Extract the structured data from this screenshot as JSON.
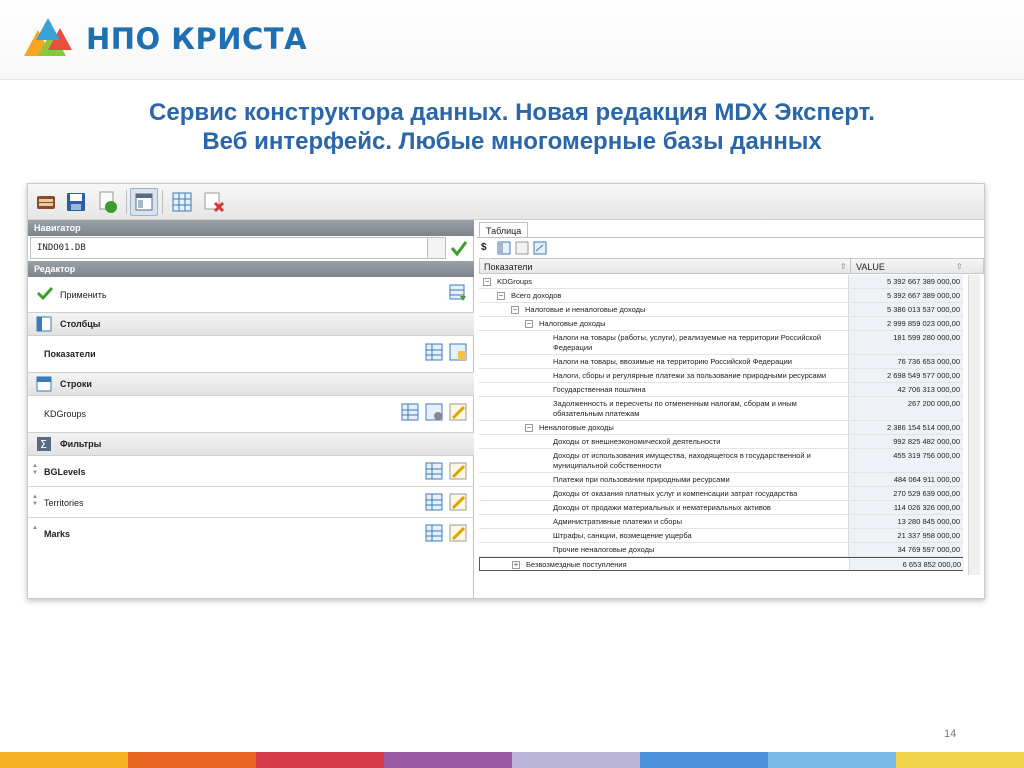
{
  "brand": {
    "name": "НПО КРИСТА"
  },
  "slide": {
    "title_line1": "Сервис конструктора данных. Новая редакция MDX Эксперт.",
    "title_line2": "Веб интерфейс. Любые многомерные базы данных",
    "page_number": "14"
  },
  "toolbar": {
    "buttons": [
      "open-icon",
      "save-icon",
      "run-icon",
      "layout-icon",
      "table-icon",
      "delete-table-icon"
    ]
  },
  "left": {
    "navigator_label": "Навигатор",
    "navigator_value": "INDO01.DB",
    "editor_label": "Редактор",
    "apply_label": "Применить",
    "columns_label": "Столбцы",
    "columns_item": "Показатели",
    "rows_label": "Строки",
    "rows_item": "KDGroups",
    "filters_label": "Фильтры",
    "filters": [
      "BGLevels",
      "Territories",
      "Marks"
    ]
  },
  "right": {
    "tab_label": "Таблица",
    "col_indicators": "Показатели",
    "col_value": "VALUE",
    "rows": [
      {
        "level": 0,
        "toggle": "minus",
        "name": "KDGroups",
        "value": "5 392 667 389 000,00"
      },
      {
        "level": 1,
        "toggle": "minus",
        "name": "Всего доходов",
        "value": "5 392 667 389 000,00"
      },
      {
        "level": 2,
        "toggle": "minus",
        "name": "Налоговые и неналоговые доходы",
        "value": "5 386 013 537 000,00"
      },
      {
        "level": 3,
        "toggle": "minus",
        "name": "Налоговые доходы",
        "value": "2 999 859 023 000,00"
      },
      {
        "level": 4,
        "toggle": "",
        "name": "Налоги на товары (работы, услуги), реализуемые на территории Российской Федерации",
        "value": "181 599 280 000,00",
        "tall": true
      },
      {
        "level": 4,
        "toggle": "",
        "name": "Налоги на товары, ввозимые на территорию Российской Федерации",
        "value": "76 736 653 000,00"
      },
      {
        "level": 4,
        "toggle": "",
        "name": "Налоги, сборы и регулярные платежи за пользование природными ресурсами",
        "value": "2 698 549 577 000,00"
      },
      {
        "level": 4,
        "toggle": "",
        "name": "Государственная пошлина",
        "value": "42 706 313 000,00"
      },
      {
        "level": 4,
        "toggle": "",
        "name": "Задолженность и пересчеты по отмененным налогам, сборам и иным обязательным платежам",
        "value": "267 200 000,00",
        "tall": true
      },
      {
        "level": 3,
        "toggle": "minus",
        "name": "Неналоговые доходы",
        "value": "2 386 154 514 000,00"
      },
      {
        "level": 4,
        "toggle": "",
        "name": "Доходы от внешнеэкономической деятельности",
        "value": "992 825 482 000,00"
      },
      {
        "level": 4,
        "toggle": "",
        "name": "Доходы от использования имущества, находящегося в государственной и муниципальной собственности",
        "value": "455 319 756 000,00",
        "tall": true
      },
      {
        "level": 4,
        "toggle": "",
        "name": "Платежи при пользовании природными ресурсами",
        "value": "484 064 911 000,00"
      },
      {
        "level": 4,
        "toggle": "",
        "name": "Доходы от оказания платных услуг и компенсации затрат государства",
        "value": "270 529 639 000,00"
      },
      {
        "level": 4,
        "toggle": "",
        "name": "Доходы от продажи материальных и нематериальных активов",
        "value": "114 026 326 000,00"
      },
      {
        "level": 4,
        "toggle": "",
        "name": "Административные платежи и сборы",
        "value": "13 280 845 000,00"
      },
      {
        "level": 4,
        "toggle": "",
        "name": "Штрафы, санкции, возмещение ущерба",
        "value": "21 337 958 000,00"
      },
      {
        "level": 4,
        "toggle": "",
        "name": "Прочие неналоговые доходы",
        "value": "34 769 597 000,00"
      },
      {
        "level": 2,
        "toggle": "plus",
        "name": "Безвозмездные поступления",
        "value": "6 653 852 000,00",
        "selected": true
      }
    ]
  },
  "colors": {
    "brand_blue": "#1f6fb3",
    "title_blue": "#2a66a8",
    "footer": [
      "#f5b324",
      "#e8661f",
      "#d73a4a",
      "#9b5aa6",
      "#b9b3d6",
      "#4a90d9",
      "#7ab8e8",
      "#f1d44a"
    ]
  }
}
